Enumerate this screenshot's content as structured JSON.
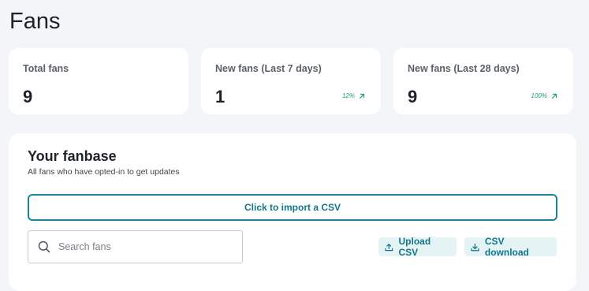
{
  "page": {
    "title": "Fans"
  },
  "stats": [
    {
      "label": "Total fans",
      "value": "9",
      "change": ""
    },
    {
      "label": "New fans (Last 7 days)",
      "value": "1",
      "change": "12%"
    },
    {
      "label": "New fans (Last 28 days)",
      "value": "9",
      "change": "100%"
    }
  ],
  "fanbase": {
    "title": "Your fanbase",
    "subtitle": "All fans who have opted-in to get updates",
    "import_label": "Click to import a CSV",
    "search_placeholder": "Search fans",
    "search_value": "",
    "upload_label": "Upload CSV",
    "download_label": "CSV download"
  },
  "icons": {
    "trend": "arrow-up-right-icon",
    "search": "search-icon",
    "upload": "upload-icon",
    "download": "download-icon"
  },
  "colors": {
    "accent": "#127789",
    "positive": "#1f9d6b",
    "background": "#f3f5f9"
  }
}
